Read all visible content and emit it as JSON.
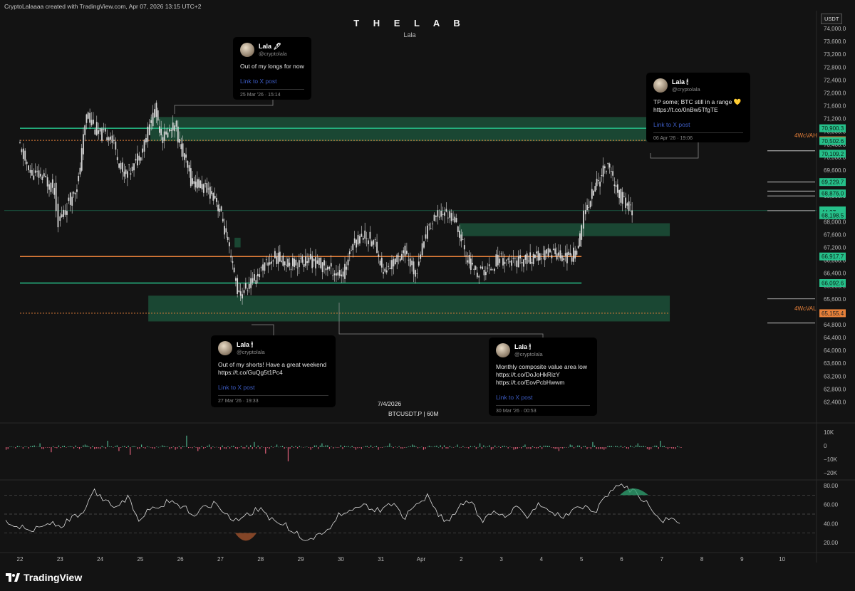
{
  "header": {
    "attribution": "CryptoLalaaaa created with TradingView.com, Apr 07, 2026 13:15 UTC+2",
    "title": "T H E   L A B",
    "subtitle": "Lala",
    "currency": "USDT",
    "date_label": "7/4/2026",
    "symbol_label": "BTCUSDT.P | 60M",
    "brand": "TradingView"
  },
  "colors": {
    "background": "#131313",
    "zone_green": "#1d5a3f",
    "line_green": "#26c08a",
    "line_orange": "#e8813a",
    "candle": "#d6d6d6",
    "rsi_line": "#dcdcdc",
    "volume_up": "#4fb28c",
    "volume_down": "#e0607a"
  },
  "tweets": [
    {
      "name": "Lala 🖊",
      "handle": "@cryptolala",
      "text": "Out of my longs for now",
      "link": "Link to X post",
      "date": "25 Mar '26 · 15:14"
    },
    {
      "name": "Lala 🕯",
      "handle": "@cryptolala",
      "text": "TP some; BTC still in a range 💛\nhttps://t.co/0nBw5TfgTE",
      "link": "Link to X post",
      "date": "06 Apr '26 · 19:06"
    },
    {
      "name": "Lala 🕯",
      "handle": "@cryptolala",
      "text": "Out of my shorts! Have a great weekend\nhttps://t.co/GuQg5t1Pc4",
      "link": "Link to X post",
      "date": "27 Mar '26 · 19:33"
    },
    {
      "name": "Lala 🕯",
      "handle": "@cryptolala",
      "text": "Monthly composite value area low\nhttps://t.co/DoJoHkRizY\nhttps://t.co/EovPcbHwwm",
      "link": "Link to X post",
      "date": "30 Mar '26 · 00:53"
    }
  ],
  "chart_data": [
    {
      "type": "candlestick",
      "title": "THE LAB",
      "symbol": "BTCUSDT.P",
      "interval": "60M",
      "y_axis": {
        "unit": "USDT",
        "range": [
          62000,
          74200
        ],
        "ticks": [
          "74,000.0",
          "73,600.0",
          "73,200.0",
          "72,800.0",
          "72,400.0",
          "72,000.0",
          "71,600.0",
          "71,200.0",
          "70,800.0",
          "70,400.0",
          "70,000.0",
          "69,600.0",
          "69,200.0",
          "68,800.0",
          "68,400.0",
          "68,000.0",
          "67,600.0",
          "67,200.0",
          "66,800.0",
          "66,400.0",
          "66,000.0",
          "65,600.0",
          "65,200.0",
          "64,800.0",
          "64,400.0",
          "64,000.0",
          "63,600.0",
          "63,200.0",
          "62,800.0",
          "62,400.0"
        ]
      },
      "x_axis": {
        "ticks": [
          "22",
          "23",
          "24",
          "25",
          "26",
          "27",
          "28",
          "29",
          "30",
          "31",
          "Apr",
          "2",
          "3",
          "4",
          "5",
          "6",
          "7",
          "8",
          "9",
          "10"
        ]
      },
      "price_path": [
        [
          22.0,
          70400
        ],
        [
          22.3,
          69500
        ],
        [
          22.6,
          69400
        ],
        [
          22.9,
          69000
        ],
        [
          23.0,
          68000
        ],
        [
          23.3,
          68700
        ],
        [
          23.5,
          69300
        ],
        [
          23.7,
          71400
        ],
        [
          24.0,
          70700
        ],
        [
          24.3,
          70700
        ],
        [
          24.6,
          69500
        ],
        [
          24.8,
          69600
        ],
        [
          25.1,
          70300
        ],
        [
          25.4,
          71500
        ],
        [
          25.6,
          70600
        ],
        [
          25.9,
          71000
        ],
        [
          26.1,
          70100
        ],
        [
          26.3,
          69300
        ],
        [
          26.7,
          69000
        ],
        [
          26.9,
          68800
        ],
        [
          27.1,
          68000
        ],
        [
          27.3,
          66800
        ],
        [
          27.5,
          65700
        ],
        [
          27.8,
          66100
        ],
        [
          28.1,
          66600
        ],
        [
          28.4,
          66900
        ],
        [
          28.8,
          66700
        ],
        [
          29.2,
          66800
        ],
        [
          29.5,
          66700
        ],
        [
          29.8,
          66500
        ],
        [
          30.1,
          66300
        ],
        [
          30.3,
          67300
        ],
        [
          30.6,
          67600
        ],
        [
          30.9,
          67300
        ],
        [
          31.1,
          66400
        ],
        [
          31.4,
          66800
        ],
        [
          31.6,
          67100
        ],
        [
          31.9,
          66400
        ],
        [
          32.2,
          67800
        ],
        [
          32.5,
          68300
        ],
        [
          32.8,
          68200
        ],
        [
          33.0,
          67600
        ],
        [
          33.2,
          66800
        ],
        [
          33.4,
          66400
        ],
        [
          33.7,
          66500
        ],
        [
          34.0,
          66900
        ],
        [
          34.3,
          66700
        ],
        [
          34.6,
          66800
        ],
        [
          35.0,
          66900
        ],
        [
          35.3,
          67100
        ],
        [
          35.6,
          66900
        ],
        [
          35.8,
          66900
        ],
        [
          36.0,
          67500
        ],
        [
          36.1,
          68200
        ],
        [
          36.3,
          68900
        ],
        [
          36.5,
          69400
        ],
        [
          36.7,
          69800
        ],
        [
          36.9,
          69000
        ],
        [
          37.1,
          68600
        ],
        [
          37.3,
          68300
        ]
      ],
      "levels": [
        {
          "label": "70,900.3",
          "value": 70900.3,
          "color": "#26c08a"
        },
        {
          "label": "70,526.1",
          "value": 70526.1,
          "color": "#e8813a",
          "tag": "4WcVAH"
        },
        {
          "label": "70,502.6",
          "value": 70502.6,
          "color": "#26c08a"
        },
        {
          "label": "70,109.2",
          "value": 70109.2,
          "color": "#26c08a"
        },
        {
          "label": "69,229.7",
          "value": 69229.7,
          "color": "#26c08a"
        },
        {
          "label": "68,876.0",
          "value": 68876.0,
          "color": "#26c08a"
        },
        {
          "label": "68,349.6",
          "value": 68349.6,
          "color": "#26c08a"
        },
        {
          "label": "68,341.3",
          "value": 68341.3,
          "color": "#26c08a"
        },
        {
          "label": "44:37",
          "value": 68290,
          "color": "#26c08a"
        },
        {
          "label": "68,198.5",
          "value": 68198.5,
          "color": "#26c08a"
        },
        {
          "label": "66,917.7",
          "value": 66917.7,
          "color": "#26c08a"
        },
        {
          "label": "66,092.6",
          "value": 66092.6,
          "color": "#26c08a"
        },
        {
          "label": "65,155.4",
          "value": 65155.4,
          "color": "#e8813a",
          "tag": "4WcVAL"
        }
      ],
      "zones": [
        {
          "name": "upper-zone",
          "from_x": 25.25,
          "to_x": 38.2,
          "low": 70500,
          "high": 71250
        },
        {
          "name": "mid-zone",
          "from_x": 32.95,
          "to_x": 38.2,
          "low": 67550,
          "high": 67950
        },
        {
          "name": "lower-zone",
          "from_x": 25.2,
          "to_x": 38.2,
          "low": 64900,
          "high": 65700
        },
        {
          "name": "small-zone",
          "from_x": 27.35,
          "to_x": 27.5,
          "low": 67200,
          "high": 67500
        }
      ],
      "lines": [
        {
          "name": "green-upper-line",
          "value": 70900,
          "from_x": 22.0,
          "to_x": 38.2
        },
        {
          "name": "orange-dotted-vah",
          "value": 70526,
          "from_x": 22.0,
          "to_x": 38.2,
          "dotted": true
        },
        {
          "name": "orange-poc-line",
          "value": 66918,
          "from_x": 22.0,
          "to_x": 36.0
        },
        {
          "name": "green-lower-line",
          "value": 66093,
          "from_x": 22.0,
          "to_x": 36.0
        },
        {
          "name": "orange-dotted-val",
          "value": 65155,
          "from_x": 22.0,
          "to_x": 38.2,
          "dotted": true
        }
      ]
    },
    {
      "type": "bar",
      "name": "volume delta",
      "y_axis": {
        "ticks": [
          "10K",
          "0",
          "−10K",
          "−20K"
        ]
      },
      "values": [
        -2,
        1,
        -1,
        3,
        -4,
        1,
        -1,
        2,
        -1,
        5,
        -3,
        -6,
        2,
        -1,
        1,
        -2,
        9,
        -3,
        2,
        -2,
        1,
        -1,
        4,
        -5,
        2,
        -11,
        1,
        -2,
        3,
        -1,
        1,
        -2,
        1,
        -2,
        3,
        -1,
        2,
        -2,
        1,
        -1,
        2,
        -1,
        3,
        -2,
        1,
        -2,
        2,
        -1,
        1,
        -3,
        2,
        -1,
        4,
        -2,
        1,
        -1,
        3,
        -2,
        5,
        -1
      ]
    },
    {
      "type": "line",
      "name": "RSI",
      "y_axis": {
        "range": [
          15,
          85
        ],
        "ticks": [
          "80.00",
          "60.00",
          "40.00",
          "20.00"
        ],
        "bands": [
          70,
          50,
          30
        ]
      },
      "values": [
        43,
        38,
        33,
        35,
        41,
        37,
        46,
        50,
        74,
        63,
        58,
        67,
        45,
        56,
        60,
        64,
        57,
        49,
        58,
        62,
        47,
        45,
        52,
        55,
        44,
        40,
        30,
        24,
        26,
        33,
        48,
        55,
        61,
        53,
        56,
        63,
        45,
        64,
        68,
        48,
        43,
        58,
        63,
        41,
        52,
        48,
        56,
        49,
        62,
        55,
        47,
        52,
        58,
        50,
        66,
        81,
        78,
        71,
        58,
        42,
        44,
        40
      ]
    }
  ]
}
